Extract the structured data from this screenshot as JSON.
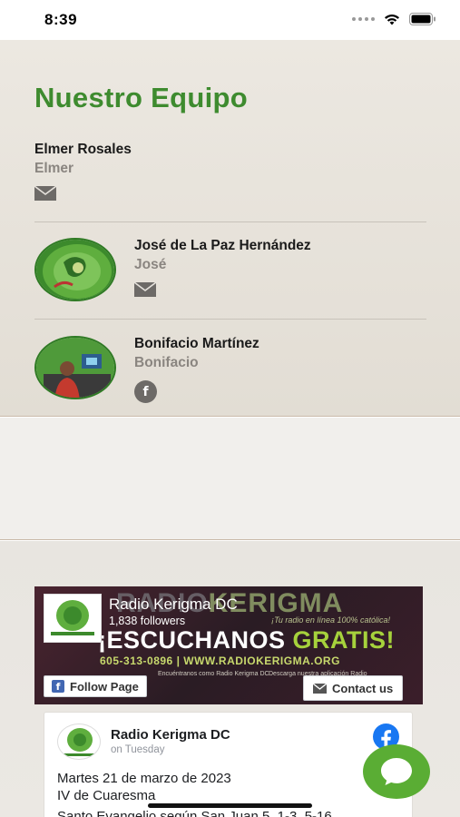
{
  "status_bar": {
    "time": "8:39"
  },
  "team": {
    "title": "Nuestro Equipo",
    "members": [
      {
        "name": "Elmer Rosales",
        "nickname": "Elmer",
        "contact_icon": "mail-icon"
      },
      {
        "name": "José de La Paz Hernández",
        "nickname": "José",
        "contact_icon": "mail-icon"
      },
      {
        "name": "Bonifacio Martínez",
        "nickname": "Bonifacio",
        "contact_icon": "facebook-icon"
      }
    ]
  },
  "facebook_widget": {
    "page_name": "Radio Kerigma DC",
    "followers": "1,838 followers",
    "cover": {
      "brand_left": "RADIO",
      "brand_right": "KERIGMA",
      "tagline": "¡Tu radio en línea 100% católica!",
      "headline": "¡ESCUCHANOS",
      "headline_accent": "GRATIS!",
      "phone_line": "605-313-0896  |  WWW.RADIOKERIGMA.ORG",
      "small_left": "Encuéntranos como Radio Kerigma DC",
      "small_right": "Descarga nuestra aplicación Radio"
    },
    "follow_button": "Follow Page",
    "contact_button": "Contact us",
    "post": {
      "author": "Radio Kerigma DC",
      "date": "on Tuesday",
      "lines": [
        "Martes 21 de marzo de 2023",
        "IV de Cuaresma",
        "Santo Evangelio según San Juan 5, 1-3, 5-16"
      ]
    }
  },
  "colors": {
    "title_green": "#3e8b2f",
    "chat_green": "#5aad34",
    "facebook_blue": "#1877f2"
  }
}
